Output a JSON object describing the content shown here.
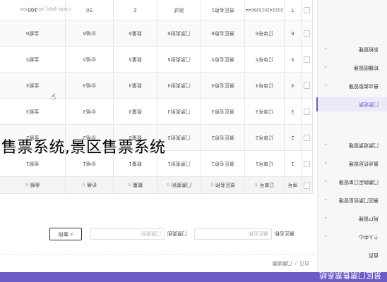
{
  "caption": "售票系统,景区售票系统",
  "header": {
    "title": "景区门票售票系统"
  },
  "breadcrumb": {
    "home": "首页",
    "separator": "/",
    "current": "门票退票"
  },
  "sidebar": {
    "items": [
      {
        "label": "首页",
        "chevron": ""
      },
      {
        "label": "个人中心",
        "chevron": "⌄"
      },
      {
        "label": "用户管理",
        "chevron": "⌄"
      },
      {
        "label": "景区门票信息管理",
        "chevron": "⌄"
      },
      {
        "label": "门票购买订单管理",
        "chevron": "⌄"
      },
      {
        "label": "景点信息管理",
        "chevron": "⌄"
      },
      {
        "label": "门票退票管理",
        "chevron": "⌄"
      },
      {
        "label": "门票退票",
        "chevron": ""
      },
      {
        "label": "景点类型管理",
        "chevron": "⌄"
      },
      {
        "label": "轮播图管理",
        "chevron": "⌄"
      },
      {
        "label": "系统管理",
        "chevron": "⌄"
      }
    ]
  },
  "search": {
    "field1_label": "景区名称",
    "field1_placeholder": "景区名称",
    "field2_label": "门票类别",
    "field2_placeholder": "门票类别",
    "button_label": "查询"
  },
  "table": {
    "headers": [
      "",
      "序号",
      "订单号",
      "景区名称",
      "门票类别",
      "数量",
      "价格",
      "金额"
    ],
    "rows": [
      [
        "1",
        "订单号1",
        "景区名称1",
        "门票类别1",
        "数量1",
        "价格1",
        "金额1"
      ],
      [
        "2",
        "订单号2",
        "景区名称2",
        "门票类别2",
        "数量2",
        "价格2",
        "金额2"
      ],
      [
        "3",
        "订单号3",
        "景区名称3",
        "门票类别3",
        "数量3",
        "价格3",
        "金额3"
      ],
      [
        "4",
        "订单号4",
        "景区名称4",
        "门票类别4",
        "数量4",
        "价格4",
        "金额4"
      ],
      [
        "5",
        "订单号5",
        "景区名称5",
        "门票类别5",
        "数量5",
        "价格5",
        "金额5"
      ],
      [
        "6",
        "订单号6",
        "景区名称6",
        "门票类别6",
        "数量6",
        "价格6",
        "金额6"
      ],
      [
        "7",
        "2022420152904428",
        "景区名称1",
        "测试",
        "2",
        "50",
        "100"
      ]
    ]
  },
  "watermark": "CSDN @QQ_402290499"
}
